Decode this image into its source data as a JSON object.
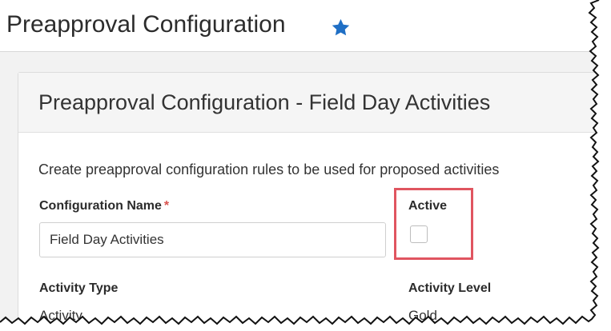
{
  "header": {
    "title": "Preapproval Configuration",
    "favorite_icon": "star-icon",
    "favorite_color": "#1f6fc5"
  },
  "card": {
    "title": "Preapproval Configuration - Field Day Activities",
    "description": "Create preapproval configuration rules to be used for proposed activities"
  },
  "form": {
    "configuration_name": {
      "label": "Configuration Name",
      "required_marker": "*",
      "value": "Field Day Activities"
    },
    "active": {
      "label": "Active",
      "checked": false
    },
    "activity_type": {
      "label": "Activity Type",
      "value": "Activity"
    },
    "activity_level": {
      "label": "Activity Level",
      "value": "Gold"
    }
  },
  "annotation": {
    "highlight_color": "#e05560"
  }
}
